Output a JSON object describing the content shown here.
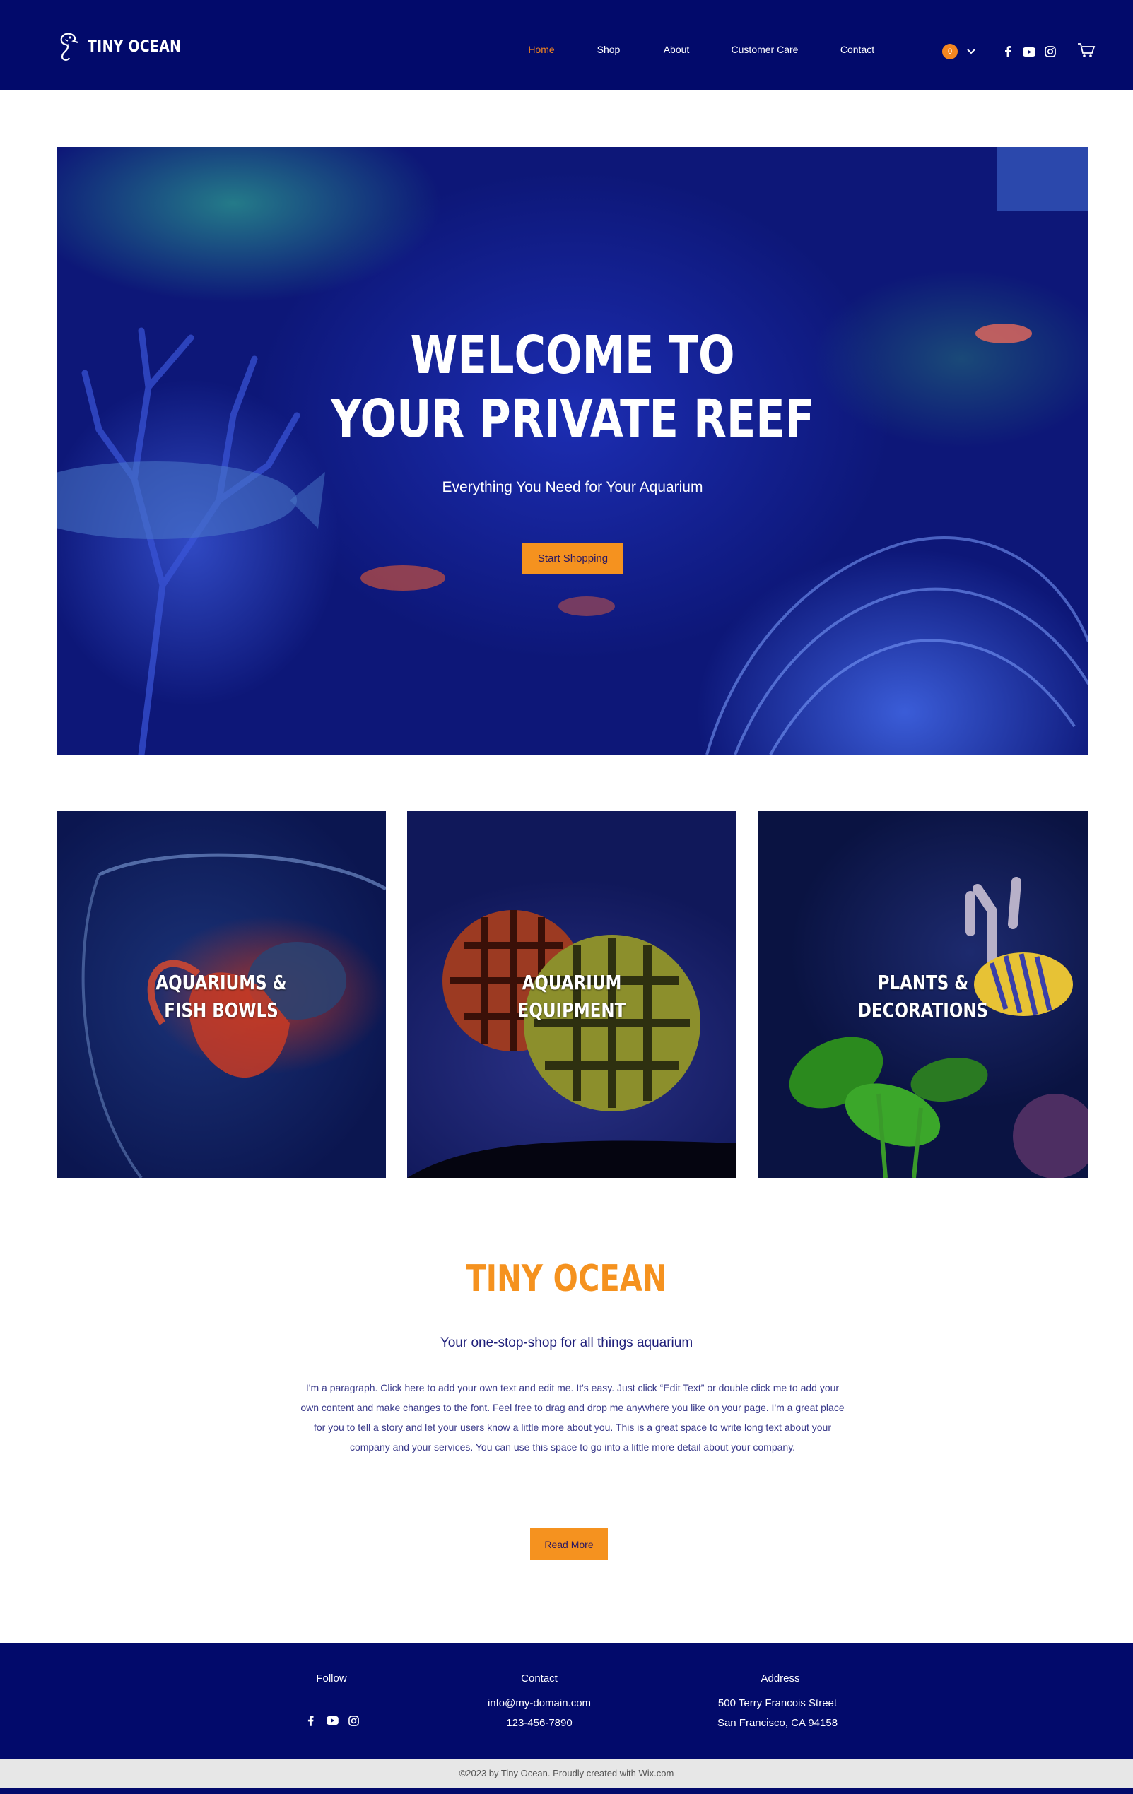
{
  "brand": {
    "name": "TINY OCEAN"
  },
  "nav": {
    "items": [
      "Home",
      "Shop",
      "About",
      "Customer Care",
      "Contact"
    ],
    "active": "Home"
  },
  "cart": {
    "count": "0"
  },
  "colors": {
    "navy": "#020a6b",
    "accent": "#f5921f",
    "white": "#ffffff",
    "footer_bar": "#e7e7e7"
  },
  "social_icons": [
    "facebook-icon",
    "youtube-icon",
    "instagram-icon"
  ],
  "hero": {
    "title_line1": "WELCOME TO",
    "title_line2": "YOUR PRIVATE REEF",
    "subtitle": "Everything You Need for Your Aquarium",
    "cta": "Start Shopping"
  },
  "categories": [
    {
      "line1": "AQUARIUMS &",
      "line2": "FISH BOWLS"
    },
    {
      "line1": "AQUARIUM",
      "line2": "EQUIPMENT"
    },
    {
      "line1": "PLANTS &",
      "line2": "DECORATIONS"
    }
  ],
  "about": {
    "title": "TINY OCEAN",
    "subtitle": "Your one-stop-shop for all things aquarium",
    "paragraph": "I'm a paragraph. Click here to add your own text and edit me. It's easy. Just click “Edit Text” or double click me to add your own content and make changes to the font. Feel free to drag and drop me anywhere you like on your page. I'm a great place for you to tell a story and let your users know a little more about you. This is a great space to write long text about your company and your services. You can use this space to go into a little more detail about your company.",
    "cta": "Read More"
  },
  "footer": {
    "follow_label": "Follow",
    "contact_label": "Contact",
    "email": "info@my-domain.com",
    "phone": "123-456-7890",
    "address_label": "Address",
    "address_line1": "500 Terry Francois Street",
    "address_line2": "San Francisco, CA 94158",
    "copyright": "©2023 by Tiny Ocean. Proudly created with Wix.com"
  }
}
